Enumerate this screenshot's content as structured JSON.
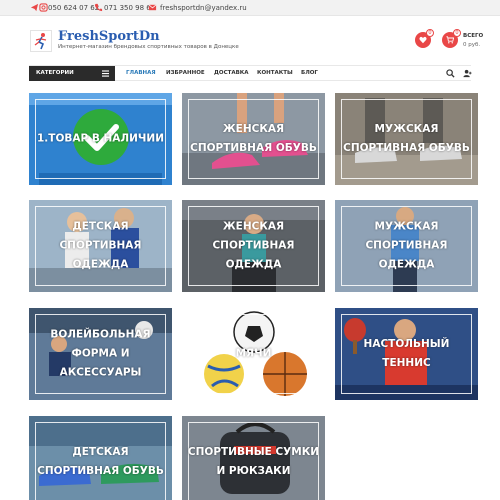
{
  "topbar": {
    "phone1": "050 624 07 62",
    "phone2": "071 350 98 62",
    "email": "freshsportdn@yandex.ru",
    "icons": [
      "telegram-icon",
      "instagram-icon",
      "phone-icon",
      "email-icon"
    ]
  },
  "header": {
    "site_name": "FreshSportDn",
    "site_desc": "Интернет-магазин брендовых спортивных товаров в Донецке",
    "wishlist_count": "0",
    "cart_count": "0",
    "cart_title": "ВСЕГО",
    "cart_total": "0 руб."
  },
  "nav": {
    "categories_label": "КАТЕГОРИИ",
    "links": [
      "ГЛАВНАЯ",
      "ИЗБРАННОЕ",
      "ДОСТАВКА",
      "КОНТАКТЫ",
      "БЛОГ"
    ],
    "active": "ГЛАВНАЯ"
  },
  "tiles": [
    {
      "label": "1.ТОВАР В НАЛИЧИИ"
    },
    {
      "label": "ЖЕНСКАЯ СПОРТИВНАЯ ОБУВЬ"
    },
    {
      "label": "МУЖСКАЯ СПОРТИВНАЯ ОБУВЬ"
    },
    {
      "label": "ДЕТСКАЯ СПОРТИВНАЯ ОДЕЖДА"
    },
    {
      "label": "ЖЕНСКАЯ СПОРТИВНАЯ ОДЕЖДА"
    },
    {
      "label": "МУЖСКАЯ СПОРТИВНАЯ ОДЕЖДА"
    },
    {
      "label": "ВОЛЕЙБОЛЬНАЯ ФОРМА И АКСЕССУАРЫ"
    },
    {
      "label": "МЯЧИ"
    },
    {
      "label": "НАСТОЛЬНЫЙ ТЕННИС"
    },
    {
      "label": "ДЕТСКАЯ СПОРТИВНАЯ ОБУВЬ"
    },
    {
      "label": "СПОРТИВНЫЕ СУМКИ И РЮКЗАКИ"
    }
  ],
  "colors": {
    "brand": "#2a5db0",
    "accent": "#e94747",
    "nav_active": "#2a7ab8"
  }
}
